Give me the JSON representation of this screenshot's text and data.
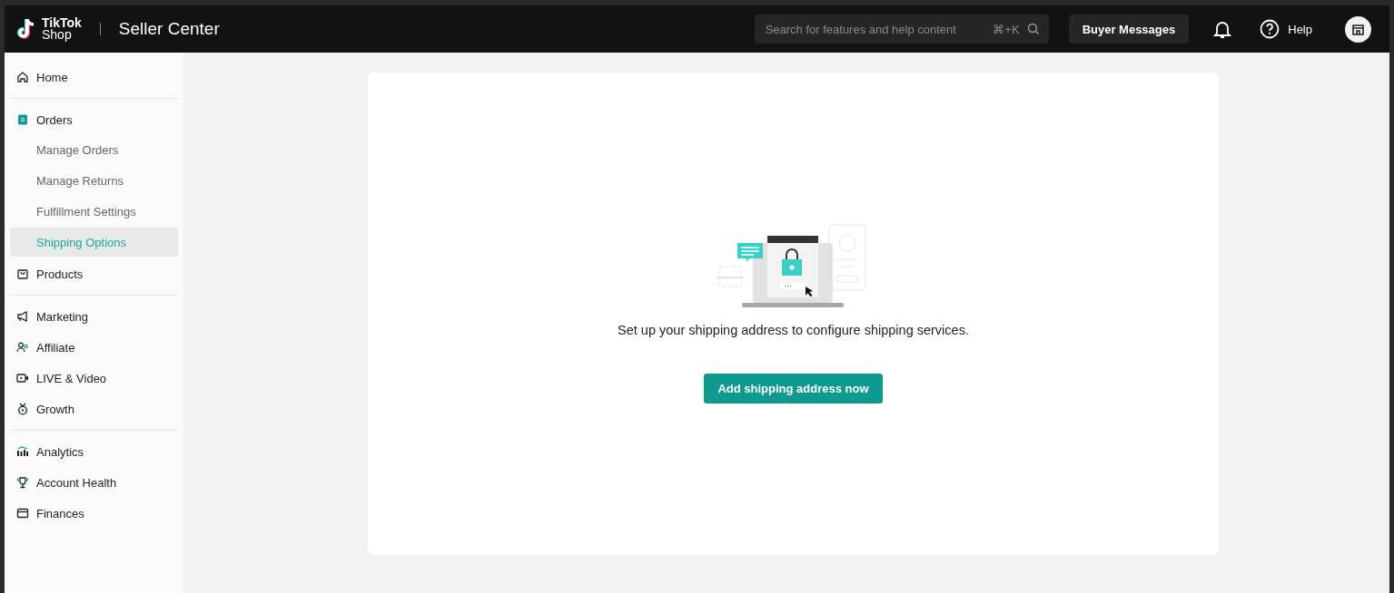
{
  "header": {
    "logo_top": "TikTok",
    "logo_bottom": "Shop",
    "title": "Seller Center",
    "search": {
      "placeholder": "Search for features and help content",
      "shortcut": "⌘+K"
    },
    "buyer_messages": "Buyer Messages",
    "help": "Help"
  },
  "sidebar": {
    "groups": [
      [
        {
          "label": "Home",
          "selected": false
        }
      ],
      [
        {
          "label": "Orders",
          "selected": true,
          "children": [
            {
              "label": "Manage Orders",
              "selected": false
            },
            {
              "label": "Manage Returns",
              "selected": false
            },
            {
              "label": "Fulfillment Settings",
              "selected": false
            },
            {
              "label": "Shipping Options",
              "selected": true
            }
          ]
        },
        {
          "label": "Products",
          "selected": false
        }
      ],
      [
        {
          "label": "Marketing",
          "selected": false
        },
        {
          "label": "Affiliate",
          "selected": false
        },
        {
          "label": "LIVE & Video",
          "selected": false
        },
        {
          "label": "Growth",
          "selected": false
        }
      ],
      [
        {
          "label": "Analytics",
          "selected": false
        },
        {
          "label": "Account Health",
          "selected": false
        },
        {
          "label": "Finances",
          "selected": false
        }
      ]
    ]
  },
  "empty_state": {
    "message": "Set up your shipping address to configure shipping services.",
    "button": "Add shipping address now"
  }
}
